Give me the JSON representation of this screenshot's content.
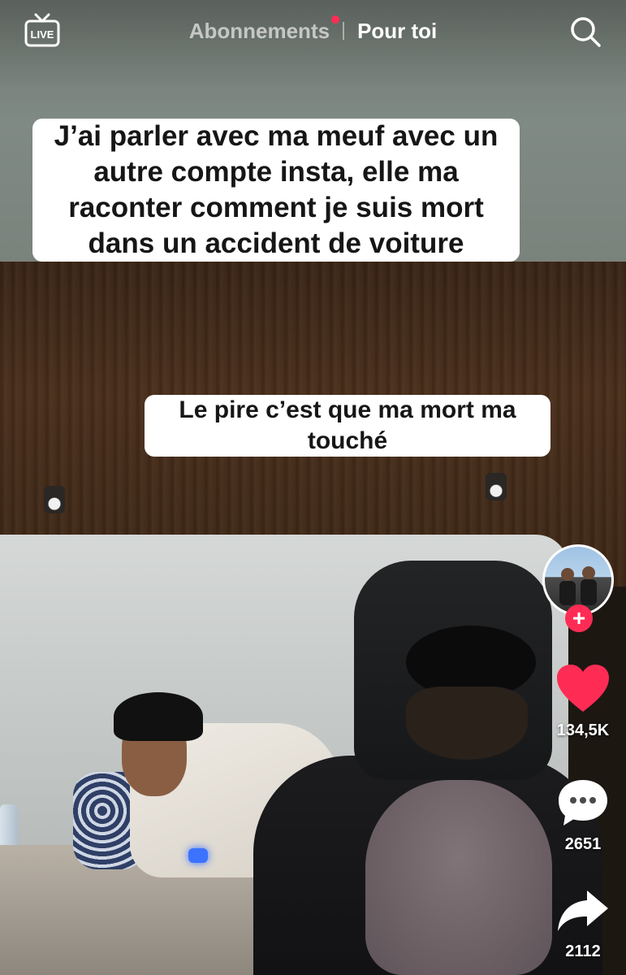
{
  "header": {
    "live_label": "LIVE",
    "tabs": [
      {
        "label": "Abonnements",
        "active": false,
        "has_notification": true
      },
      {
        "label": "Pour toi",
        "active": true
      }
    ],
    "search_icon": "search-icon"
  },
  "captions": {
    "main": "J’ai parler avec ma meuf avec un autre compte insta, elle ma raconter comment je suis mort dans un accident de voiture",
    "secondary": "Le pire c’est que ma mort ma touché"
  },
  "actions": {
    "follow_icon": "plus-icon",
    "like": {
      "icon": "heart-icon",
      "count": "134,5K",
      "color": "#fe2c55"
    },
    "comment": {
      "icon": "comment-icon",
      "count": "2651"
    },
    "share": {
      "icon": "share-icon",
      "count": "2112"
    }
  },
  "colors": {
    "accent": "#fe2c55",
    "notification_dot": "#ff2d55"
  }
}
